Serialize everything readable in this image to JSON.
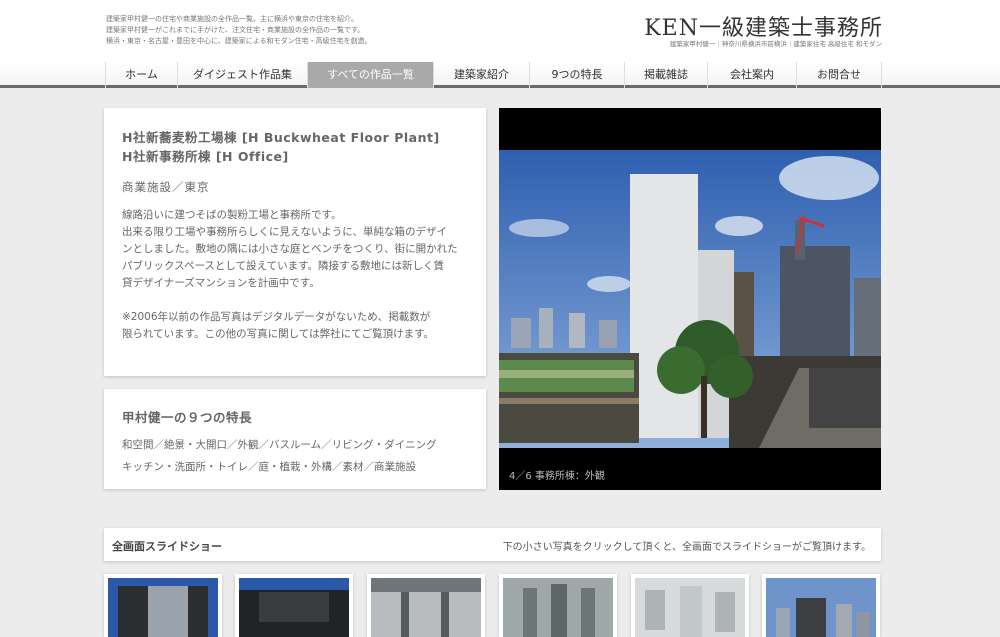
{
  "header": {
    "desc_lines": [
      "建築家甲村健一の住宅や商業施設の全作品一覧。主に横浜や東京の住宅を紹介。",
      "建築家甲村健一がこれまでに手がけた、注文住宅・商業施設の全作品の一覧です。",
      "横浜・東京・名古屋・豊田を中心に、建築家による和モダン住宅・高級住宅を創造。"
    ],
    "logo": "KEN一級建築士事務所",
    "logo_sub": "建築家甲村健一｜神奈川県横浜市前横浜｜建築家住宅 高級住宅 和モダン"
  },
  "nav": {
    "items": [
      {
        "label": "ホーム"
      },
      {
        "label": "ダイジェスト作品集"
      },
      {
        "label": "すべての作品一覧"
      },
      {
        "label": "建築家紹介"
      },
      {
        "label": "9つの特長"
      },
      {
        "label": "掲載雑誌"
      },
      {
        "label": "会社案内"
      },
      {
        "label": "お問合せ"
      }
    ],
    "active_index": 2
  },
  "work": {
    "title_lines": [
      "H社新蕎麦粉工場棟 [H Buckwheat Floor Plant]",
      "H社新事務所棟 [H Office]"
    ],
    "category": "商業施設／東京",
    "desc_lines": [
      "線路沿いに建つそばの製粉工場と事務所です。",
      "出来る限り工場や事務所らしくに見えないように、単純な箱のデザイ",
      "ンとしました。敷地の隅には小さな庭とベンチをつくり、街に開かれた",
      "パブリックスペースとして設えています。隣接する敷地には新しく賃",
      "貸デザイナーズマンションを計画中です。"
    ],
    "note_lines": [
      "※2006年以前の作品写真はデジタルデータがないため、掲載数が",
      "限られています。この他の写真に関しては弊社にてご覧頂けます。"
    ]
  },
  "features": {
    "title": "甲村健一の９つの特長",
    "lines": [
      "和空間／絶景・大開口／外観／バスルーム／リビング・ダイニング",
      "キッチン・洗面所・トイレ／庭・植栽・外構／素材／商業施設"
    ]
  },
  "photo": {
    "caption": "4／6 事務所棟：外観"
  },
  "slideshow": {
    "title": "全画面スライドショー",
    "note": "下の小さい写真をクリックして頂くと、全画面でスライドショーがご覧頂けます。"
  },
  "thumbnails": [
    {
      "name": "thumb-1"
    },
    {
      "name": "thumb-2"
    },
    {
      "name": "thumb-3"
    },
    {
      "name": "thumb-4"
    },
    {
      "name": "thumb-5"
    },
    {
      "name": "thumb-6"
    }
  ],
  "colors": {
    "background": "#ececec",
    "nav_active": "#a9a9a9",
    "nav_bottom_border": "#6a6a6a"
  }
}
